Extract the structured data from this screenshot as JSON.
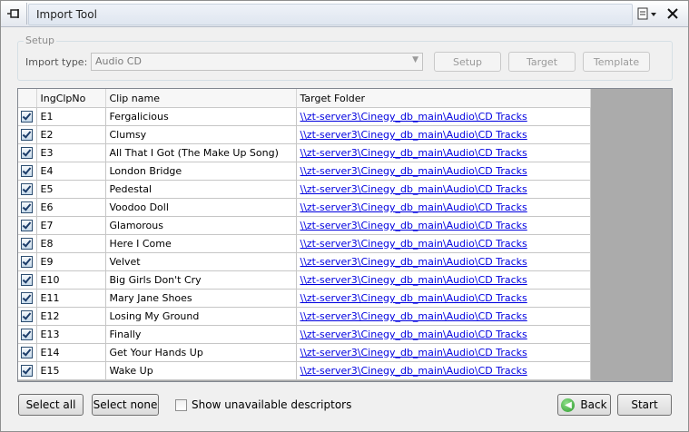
{
  "window": {
    "title": "Import Tool"
  },
  "setup": {
    "legend": "Setup",
    "import_type_label": "Import type:",
    "import_type_value": "Audio CD",
    "buttons": {
      "setup": "Setup",
      "target": "Target",
      "template": "Template"
    }
  },
  "grid": {
    "columns": {
      "id": "IngClpNo",
      "clip": "Clip name",
      "folder": "Target Folder"
    },
    "rows": [
      {
        "checked": true,
        "id": "E1",
        "clip": "Fergalicious",
        "folder": "\\\\zt-server3\\Cinegy_db_main\\Audio\\CD Tracks"
      },
      {
        "checked": true,
        "id": "E2",
        "clip": "Clumsy",
        "folder": "\\\\zt-server3\\Cinegy_db_main\\Audio\\CD Tracks"
      },
      {
        "checked": true,
        "id": "E3",
        "clip": "All That I Got (The Make Up Song)",
        "folder": "\\\\zt-server3\\Cinegy_db_main\\Audio\\CD Tracks"
      },
      {
        "checked": true,
        "id": "E4",
        "clip": "London Bridge",
        "folder": "\\\\zt-server3\\Cinegy_db_main\\Audio\\CD Tracks"
      },
      {
        "checked": true,
        "id": "E5",
        "clip": "Pedestal",
        "folder": "\\\\zt-server3\\Cinegy_db_main\\Audio\\CD Tracks"
      },
      {
        "checked": true,
        "id": "E6",
        "clip": "Voodoo Doll",
        "folder": "\\\\zt-server3\\Cinegy_db_main\\Audio\\CD Tracks"
      },
      {
        "checked": true,
        "id": "E7",
        "clip": "Glamorous",
        "folder": "\\\\zt-server3\\Cinegy_db_main\\Audio\\CD Tracks"
      },
      {
        "checked": true,
        "id": "E8",
        "clip": "Here I Come",
        "folder": "\\\\zt-server3\\Cinegy_db_main\\Audio\\CD Tracks"
      },
      {
        "checked": true,
        "id": "E9",
        "clip": "Velvet",
        "folder": "\\\\zt-server3\\Cinegy_db_main\\Audio\\CD Tracks"
      },
      {
        "checked": true,
        "id": "E10",
        "clip": "Big Girls Don't Cry",
        "folder": "\\\\zt-server3\\Cinegy_db_main\\Audio\\CD Tracks"
      },
      {
        "checked": true,
        "id": "E11",
        "clip": "Mary Jane Shoes",
        "folder": "\\\\zt-server3\\Cinegy_db_main\\Audio\\CD Tracks"
      },
      {
        "checked": true,
        "id": "E12",
        "clip": "Losing My Ground",
        "folder": "\\\\zt-server3\\Cinegy_db_main\\Audio\\CD Tracks"
      },
      {
        "checked": true,
        "id": "E13",
        "clip": "Finally",
        "folder": "\\\\zt-server3\\Cinegy_db_main\\Audio\\CD Tracks"
      },
      {
        "checked": true,
        "id": "E14",
        "clip": "Get Your Hands Up",
        "folder": "\\\\zt-server3\\Cinegy_db_main\\Audio\\CD Tracks"
      },
      {
        "checked": true,
        "id": "E15",
        "clip": "Wake Up",
        "folder": "\\\\zt-server3\\Cinegy_db_main\\Audio\\CD Tracks"
      }
    ]
  },
  "footer": {
    "select_all": "Select all",
    "select_none": "Select none",
    "show_unavailable": "Show unavailable descriptors",
    "back": "Back",
    "start": "Start"
  },
  "icons": {
    "pin": "pin-icon",
    "options": "options-icon",
    "close": "close-icon",
    "back": "back-arrow-icon",
    "dropdown": "chevron-down-icon",
    "check": "checkbox-checked-icon"
  }
}
